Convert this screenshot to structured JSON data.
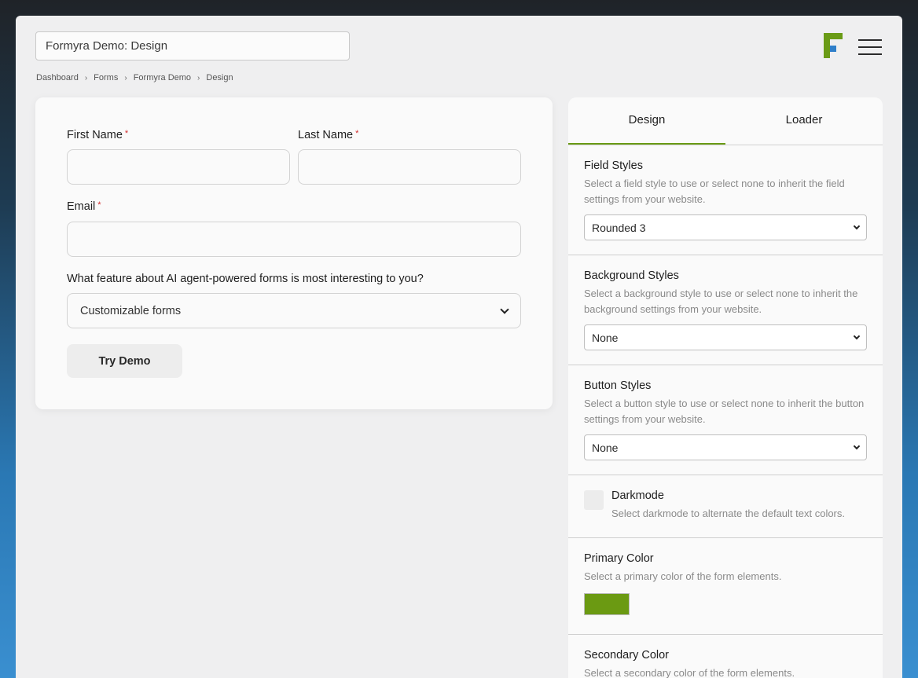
{
  "header": {
    "title_value": "Formyra Demo: Design",
    "logo_name": "formyra-logo",
    "menu_icon": "hamburger-icon"
  },
  "breadcrumb": [
    "Dashboard",
    "Forms",
    "Formyra Demo",
    "Design"
  ],
  "form": {
    "first_name_label": "First Name",
    "last_name_label": "Last Name",
    "email_label": "Email",
    "required_mark": "*",
    "feature_question": "What feature about AI agent-powered forms is most interesting to you?",
    "feature_selected": "Customizable forms",
    "submit_label": "Try Demo"
  },
  "panel": {
    "tabs": [
      {
        "label": "Design",
        "active": true
      },
      {
        "label": "Loader",
        "active": false
      }
    ],
    "field_styles": {
      "title": "Field Styles",
      "desc": "Select a field style to use or select none to inherit the field settings from your website.",
      "selected": "Rounded 3"
    },
    "background_styles": {
      "title": "Background Styles",
      "desc": "Select a background style to use or select none to inherit the background settings from your website.",
      "selected": "None"
    },
    "button_styles": {
      "title": "Button Styles",
      "desc": "Select a button style to use or select none to inherit the button settings from your website.",
      "selected": "None"
    },
    "darkmode": {
      "title": "Darkmode",
      "desc": "Select darkmode to alternate the default text colors.",
      "checked": false
    },
    "primary_color": {
      "title": "Primary Color",
      "desc": "Select a primary color of the form elements.",
      "value": "#6b9a12"
    },
    "secondary_color": {
      "title": "Secondary Color",
      "desc": "Select a secondary color of the form elements."
    }
  },
  "colors": {
    "accent": "#6a9b16",
    "required": "#d12b2b",
    "logo_green": "#6a9b16",
    "logo_blue": "#2f7fc9"
  }
}
